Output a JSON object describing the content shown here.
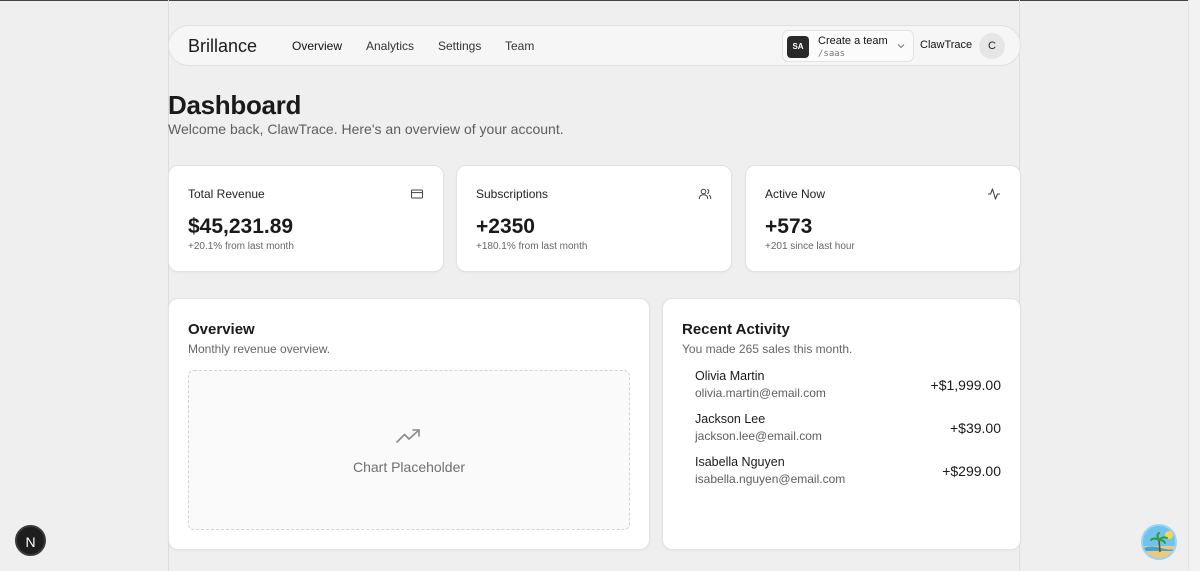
{
  "nav": {
    "brand": "Brillance",
    "links": [
      "Overview",
      "Analytics",
      "Settings",
      "Team"
    ],
    "team": {
      "avatar": "SA",
      "name": "Create a team",
      "slug": "/saas"
    },
    "user": {
      "name": "ClawTrace",
      "initial": "C"
    }
  },
  "header": {
    "title": "Dashboard",
    "subtitle": "Welcome back, ClawTrace. Here's an overview of your account."
  },
  "stats": [
    {
      "label": "Total Revenue",
      "value": "$45,231.89",
      "change": "+20.1% from last month",
      "icon": "credit-card-icon"
    },
    {
      "label": "Subscriptions",
      "value": "+2350",
      "change": "+180.1% from last month",
      "icon": "users-icon"
    },
    {
      "label": "Active Now",
      "value": "+573",
      "change": "+201 since last hour",
      "icon": "activity-icon"
    }
  ],
  "overview": {
    "title": "Overview",
    "subtitle": "Monthly revenue overview.",
    "placeholder": "Chart Placeholder",
    "icon": "trending-up-icon"
  },
  "activity": {
    "title": "Recent Activity",
    "subtitle": "You made 265 sales this month.",
    "items": [
      {
        "name": "Olivia Martin",
        "email": "olivia.martin@email.com",
        "amount": "+$1,999.00"
      },
      {
        "name": "Jackson Lee",
        "email": "jackson.lee@email.com",
        "amount": "+$39.00"
      },
      {
        "name": "Isabella Nguyen",
        "email": "isabella.nguyen@email.com",
        "amount": "+$299.00"
      }
    ]
  },
  "floating": {
    "next_badge": "N"
  }
}
